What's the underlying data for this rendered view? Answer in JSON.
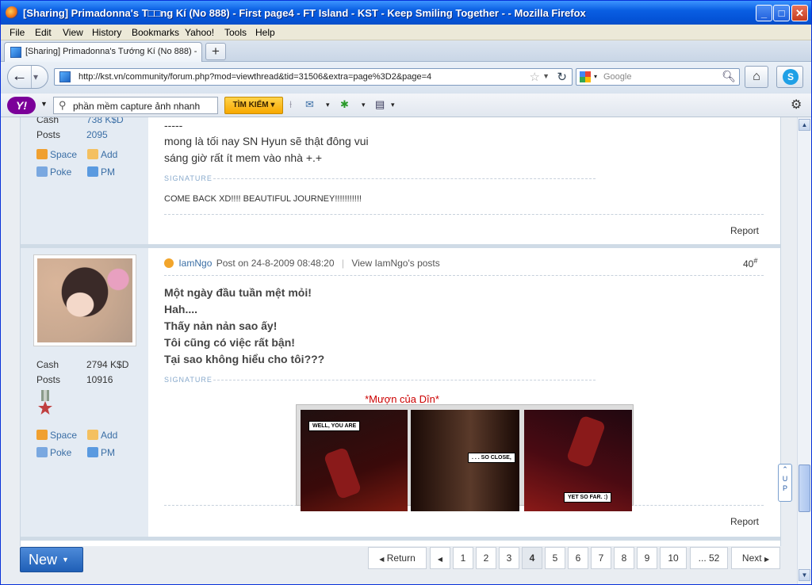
{
  "window": {
    "title": "[Sharing] Primadonna's T□□ng Kí (No 888) - First page4 - FT Island - KST - Keep Smiling Together - - Mozilla Firefox"
  },
  "menu": [
    "File",
    "Edit",
    "View",
    "History",
    "Bookmarks",
    "Yahoo!",
    "Tools",
    "Help"
  ],
  "tab": {
    "label": "[Sharing] Primadonna's Tướng Kí (No 888) - ..."
  },
  "nav": {
    "url": "http://kst.vn/community/forum.php?mod=viewthread&tid=31506&extra=page%3D2&page=4",
    "search_placeholder": "Google"
  },
  "yahoo": {
    "search_value": "phần mềm capture ảnh nhanh",
    "search_button": "TÌM KIẾM",
    "logo": "Y!"
  },
  "post1": {
    "cash_label": "Cash",
    "cash_value": "738 K$D",
    "posts_label": "Posts",
    "posts_value": "2095",
    "space": "Space",
    "add": "Add",
    "poke": "Poke",
    "pm": "PM",
    "divider": "-----",
    "line1": "mong là tối nay SN Hyun sẽ thật đông vui",
    "line2": "sáng giờ rất ít mem vào nhà +.+",
    "signature_label": "SIGNATURE",
    "signature": "COME BACK XD!!!! BEAUTIFUL JOURNEY!!!!!!!!!!!",
    "report": "Report"
  },
  "post2": {
    "author": "IamNgo",
    "posted": "Post on 24-8-2009 08:48:20",
    "view_posts": "View IamNgo's posts",
    "floor": "40",
    "floor_sup": "#",
    "cash_label": "Cash",
    "cash_value": "2794 K$D",
    "posts_label": "Posts",
    "posts_value": "10916",
    "space": "Space",
    "add": "Add",
    "poke": "Poke",
    "pm": "PM",
    "lines": [
      "Một ngày đầu tuần mệt mỏi!",
      "Hah....",
      "Thấy nản nản sao ấy!",
      "Tôi cũng có việc rất bận!",
      "Tại sao không hiểu cho tôi???"
    ],
    "signature_label": "SIGNATURE",
    "sig_caption": "*Mượn của Dîn*",
    "comic": [
      "WELL, YOU ARE",
      ". . . SO CLOSE,",
      "YET SO FAR. :)"
    ],
    "report": "Report"
  },
  "bottom": {
    "new_label": "New",
    "return_label": "Return",
    "pages": [
      "1",
      "2",
      "3",
      "4",
      "5",
      "6",
      "7",
      "8",
      "9",
      "10",
      "... 52"
    ],
    "current_page": "4",
    "next_label": "Next"
  },
  "colors": {
    "titlebar": "#0453d6",
    "link": "#3a6ea5",
    "caption_red": "#cc0000",
    "new_button": "#1f5fb6"
  }
}
